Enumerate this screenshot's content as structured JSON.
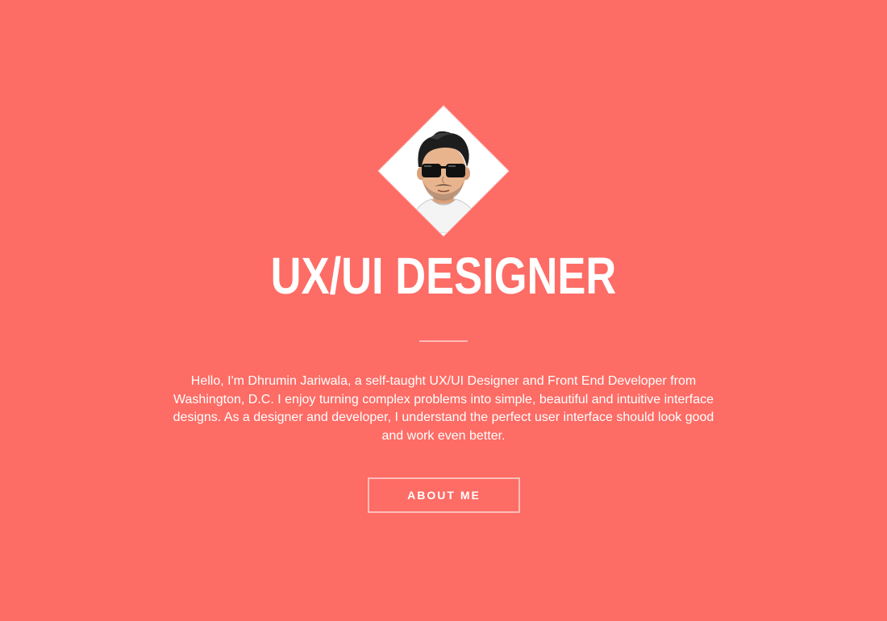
{
  "hero": {
    "avatar_icon": "avatar-cartoon-sunglasses",
    "title": "UX/UI DESIGNER",
    "intro": "Hello, I'm Dhrumin Jariwala, a self-taught UX/UI Designer and Front End Developer from Washington, D.C. I enjoy turning complex problems into simple, beautiful and intuitive interface designs. As a designer and developer, I understand the perfect user interface should look good and work even better.",
    "button_label": "ABOUT ME"
  },
  "colors": {
    "background": "#fd6c65",
    "text": "#ffffff"
  }
}
